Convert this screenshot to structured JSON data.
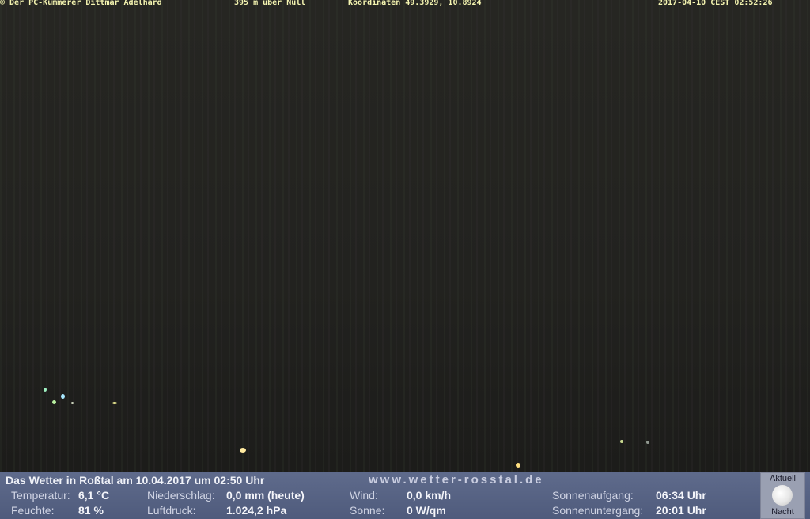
{
  "overlay_top": {
    "left": "© Der PC-Kümmerer Dittmar Adelhard",
    "altitude": "395 m über Null",
    "coords": "Koordinaten 49.3929, 10.8924",
    "timestamp": "2017-04-10 CEST 02:52:26"
  },
  "weather": {
    "title": "Das Wetter in Roßtal am 10.04.2017 um 02:50 Uhr",
    "url": "www.wetter-rosstal.de",
    "temperature_label": "Temperatur:",
    "temperature_value": "6,1 °C",
    "humidity_label": "Feuchte:",
    "humidity_value": "81 %",
    "precip_label": "Niederschlag:",
    "precip_value": "0,0 mm (heute)",
    "pressure_label": "Luftdruck:",
    "pressure_value": "1.024,2 hPa",
    "wind_label": "Wind:",
    "wind_value": "0,0 km/h",
    "sun_label": "Sonne:",
    "sun_value": "0 W/qm",
    "sunrise_label": "Sonnenaufgang:",
    "sunrise_value": "06:34 Uhr",
    "sunset_label": "Sonnenuntergang:",
    "sunset_value": "20:01 Uhr"
  },
  "moon": {
    "top_label": "Aktuell",
    "bottom_label": "Nacht",
    "icon": "moon-icon"
  }
}
